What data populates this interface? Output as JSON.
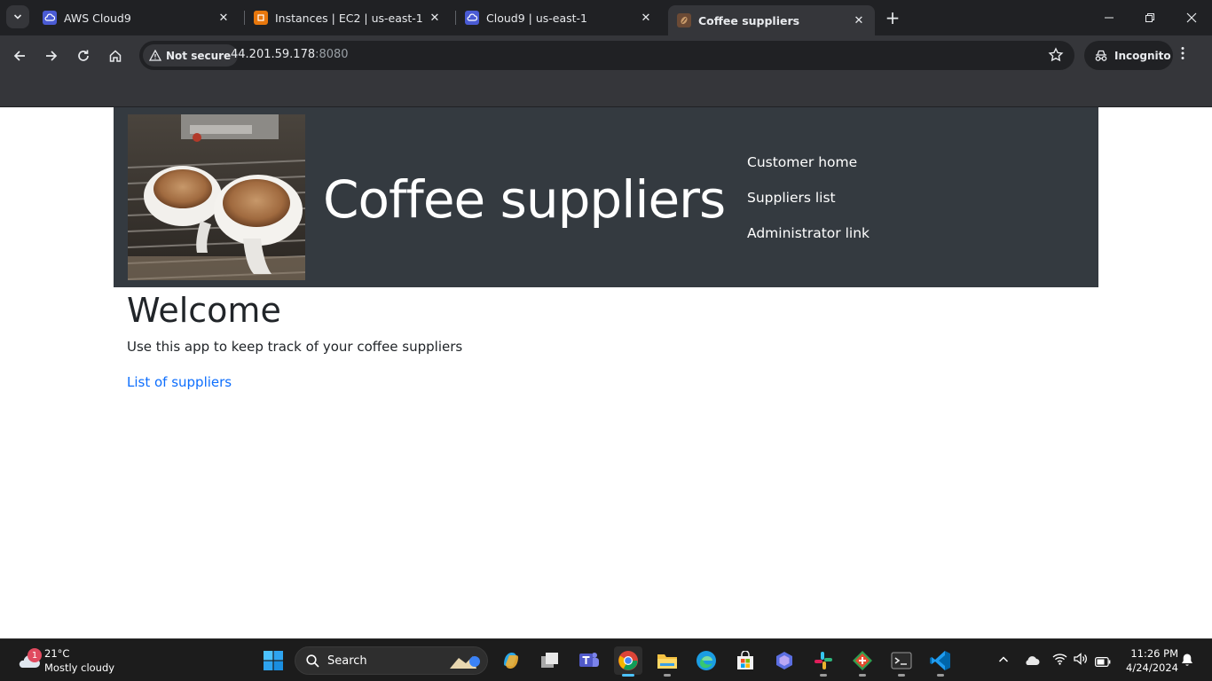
{
  "browser": {
    "tabs": [
      {
        "title": "AWS Cloud9",
        "active": false
      },
      {
        "title": "Instances | EC2 | us-east-1",
        "active": false
      },
      {
        "title": "Cloud9 | us-east-1",
        "active": false
      },
      {
        "title": "Coffee suppliers",
        "active": true
      }
    ],
    "security_chip": "Not secure",
    "url_host": "44.201.59.178",
    "url_port": ":8080",
    "profile_label": "Incognito"
  },
  "site": {
    "title": "Coffee suppliers",
    "nav": [
      {
        "label": "Customer home"
      },
      {
        "label": "Suppliers list"
      },
      {
        "label": "Administrator link"
      }
    ],
    "heading": "Welcome",
    "intro": "Use this app to keep track of your coffee suppliers",
    "link_label": "List of suppliers",
    "colors": {
      "header_bg": "#343a40",
      "link": "#0d6efd",
      "text": "#212529"
    }
  },
  "taskbar": {
    "weather_temp": "21°C",
    "weather_condition": "Mostly cloudy",
    "notification_count": "1",
    "search_label": "Search",
    "time": "11:26 PM",
    "date": "4/24/2024"
  }
}
